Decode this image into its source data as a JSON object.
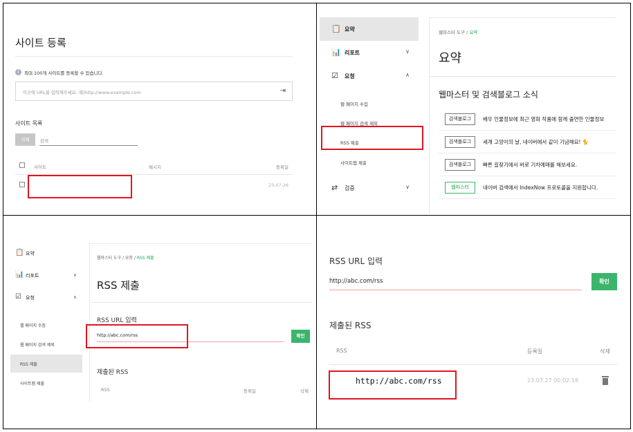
{
  "panel1": {
    "title": "사이트 등록",
    "info_icon": "info-icon",
    "info_text": "최대 100개 사이트를 등록할 수 있습니다.",
    "url_placeholder": "이곳에 URL을 입력해주세요. 예)http://www.example.com",
    "list_title": "사이트 목록",
    "delete_label": "삭제",
    "search_placeholder": "검색",
    "columns": [
      "사이트",
      "메시지",
      "등록일"
    ],
    "row": {
      "site": "",
      "message": "",
      "date": "23.07.26"
    }
  },
  "panel2": {
    "sidebar": [
      {
        "label": "요약",
        "icon": "clipboard-icon",
        "chevron": ""
      },
      {
        "label": "리포트",
        "icon": "chart-icon",
        "chevron": "∨"
      },
      {
        "label": "요청",
        "icon": "check-square-icon",
        "chevron": "∧"
      }
    ],
    "subitems": [
      "웹 페이지 수집",
      "웹 페이지 검색 제외",
      "RSS 제출",
      "사이트맵 제출"
    ],
    "verify_item": {
      "label": "검증",
      "icon": "sync-icon",
      "chevron": "∨"
    },
    "breadcrumb": {
      "root": "웹마스터 도구",
      "sep": "/",
      "current": "요약"
    },
    "title": "요약",
    "news_title": "웹마스터 및 검색블로그 소식",
    "news": [
      {
        "tag": "검색블로그",
        "text": "배우 인물정보에 최근 영화 작품에 함께 출연한 인물정보",
        "tag_color": "#777777"
      },
      {
        "tag": "검색블로그",
        "text": "세계 고양이의 날, 네이버에서 같이 기념해요! 🐈",
        "tag_color": "#777777"
      },
      {
        "tag": "검색블로그",
        "text": "빠른 길찾기에서 바로 기차예매를 해보세요.",
        "tag_color": "#777777"
      },
      {
        "tag": "웹마스터",
        "text": "네이버 검색에서 IndexNow 프로토콜을 지원합니다.",
        "tag_color": "#38b56a"
      }
    ]
  },
  "panel3": {
    "sidebar": [
      {
        "label": "요약",
        "icon": "clipboard-icon",
        "chevron": ""
      },
      {
        "label": "리포트",
        "icon": "chart-icon",
        "chevron": "∨"
      },
      {
        "label": "요청",
        "icon": "check-square-icon",
        "chevron": "∧"
      }
    ],
    "subitems": [
      "웹 페이지 수집",
      "웹 페이지 검색 제외",
      "RSS 제출",
      "사이트맵 제출"
    ],
    "breadcrumb": {
      "root": "웹마스터 도구",
      "sep1": "/",
      "mid": "요청",
      "sep2": "/",
      "current": "RSS 제출"
    },
    "title": "RSS 제출",
    "rss_label": "RSS URL 입력",
    "rss_value": "http://abc.com/rss",
    "confirm_label": "확인",
    "submitted_title": "제출된 RSS",
    "columns": [
      "RSS",
      "등록일",
      "삭제"
    ]
  },
  "panel4": {
    "rss_label": "RSS URL 입력",
    "rss_value": "http://abc.com/rss",
    "confirm_label": "확인",
    "submitted_title": "제출된 RSS",
    "columns": [
      "RSS",
      "등록일",
      "삭제"
    ],
    "row": {
      "url": "http://abc.com/rss",
      "date": "23.07.27 00:02:18",
      "delete_icon": "trash-icon"
    }
  },
  "colors": {
    "accent_green": "#3bb56b",
    "highlight_red": "#e0141e",
    "breadcrumb_green": "#17a84b"
  }
}
